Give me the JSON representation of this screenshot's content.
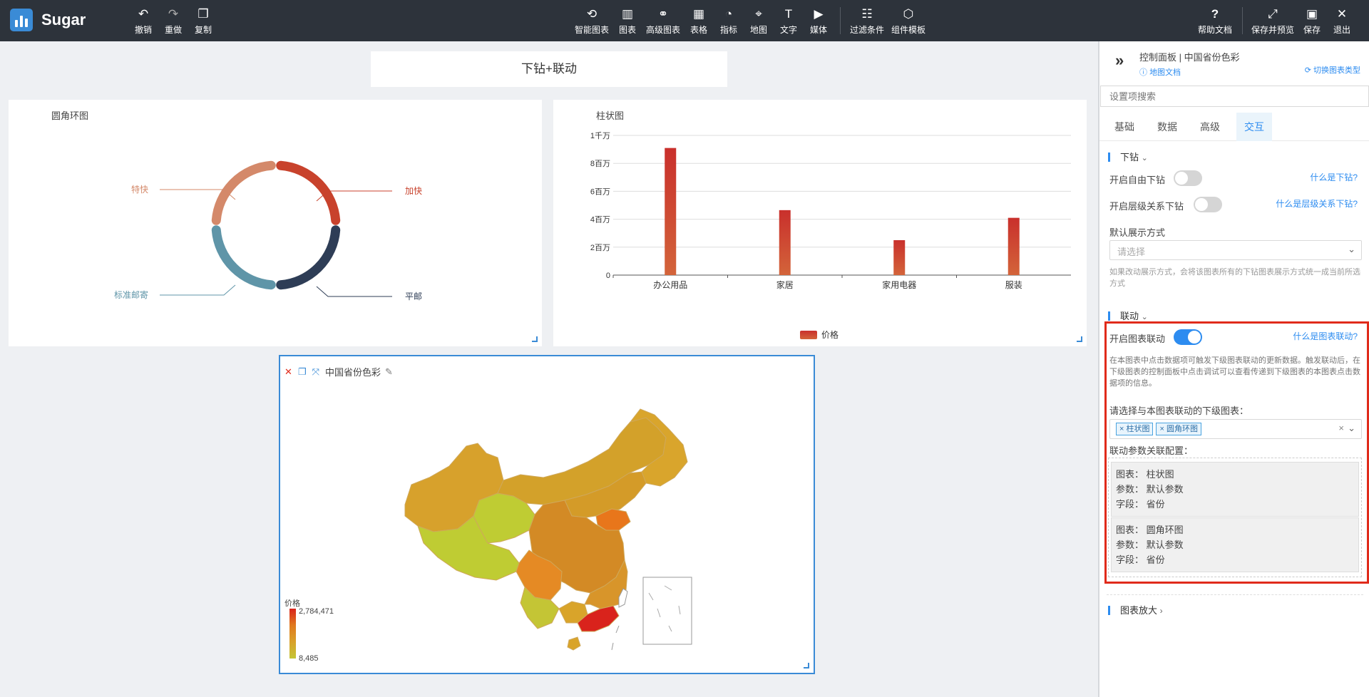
{
  "app": {
    "name": "Sugar"
  },
  "toolbar": {
    "undo": "撤销",
    "redo": "重做",
    "copy": "复制",
    "smart_chart": "智能图表",
    "chart": "图表",
    "advanced_chart": "高级图表",
    "table": "表格",
    "indicator": "指标",
    "map": "地图",
    "text": "文字",
    "media": "媒体",
    "filter": "过滤条件",
    "template": "组件模板",
    "help": "帮助文档",
    "save_preview": "保存并预览",
    "save": "保存",
    "exit": "退出"
  },
  "dashboard": {
    "title": "下钻+联动"
  },
  "donut": {
    "title": "圆角环图",
    "slices": [
      {
        "name": "加快",
        "value": 25,
        "color": "#c8422c"
      },
      {
        "name": "平邮",
        "value": 25,
        "color": "#2e3d56"
      },
      {
        "name": "标准邮寄",
        "value": 25,
        "color": "#5f95a8"
      },
      {
        "name": "特快",
        "value": 25,
        "color": "#d4896a"
      }
    ]
  },
  "chart_data": {
    "type": "bar",
    "title": "柱状图",
    "categories": [
      "办公用品",
      "家居",
      "家用电器",
      "服装"
    ],
    "series": [
      {
        "name": "价格",
        "values": [
          9100000,
          4650000,
          2500000,
          4100000
        ]
      }
    ],
    "ylim": [
      0,
      10000000
    ],
    "yticks": [
      "0",
      "2百万",
      "4百万",
      "6百万",
      "8百万",
      "1千万"
    ],
    "legend": "bottom",
    "grid": true
  },
  "map": {
    "title": "中国省份色彩",
    "legend_title": "价格",
    "legend_max": "2,784,471",
    "legend_min": "8,485"
  },
  "panel": {
    "breadcrumb": "控制面板 | 中国省份色彩",
    "map_doc": "地图文档",
    "switch_type": "切换图表类型",
    "search_placeholder": "设置项搜索",
    "tabs": [
      "基础",
      "数据",
      "高级",
      "交互"
    ],
    "drill": {
      "title": "下钻",
      "free_drill": "开启自由下钻",
      "free_help": "什么是下钻?",
      "level_drill": "开启层级关系下钻",
      "level_help": "什么是层级关系下钻?",
      "display_label": "默认展示方式",
      "display_placeholder": "请选择",
      "display_hint": "如果改动展示方式，会将该图表所有的下钻图表展示方式统一成当前所选方式"
    },
    "link": {
      "title": "联动",
      "enable": "开启图表联动",
      "help": "什么是图表联动?",
      "desc": "在本图表中点击数据项可触发下级图表联动的更新数据。触发联动后，在下级图表的控制面板中点击调试可以查看传递到下级图表的本图表点击数据项的信息。",
      "select_label": "请选择与本图表联动的下级图表：",
      "tags": [
        "柱状图",
        "圆角环图"
      ],
      "config_label": "联动参数关联配置：",
      "configs": [
        {
          "chart": "图表：  柱状图",
          "param": "参数：  默认参数",
          "field": "字段：  省份"
        },
        {
          "chart": "图表：  圆角环图",
          "param": "参数：  默认参数",
          "field": "字段：  省份"
        }
      ]
    },
    "zoom": {
      "title": "图表放大"
    }
  },
  "colors": {
    "accent": "#2d8cf0",
    "highlight": "#e02b1b"
  }
}
